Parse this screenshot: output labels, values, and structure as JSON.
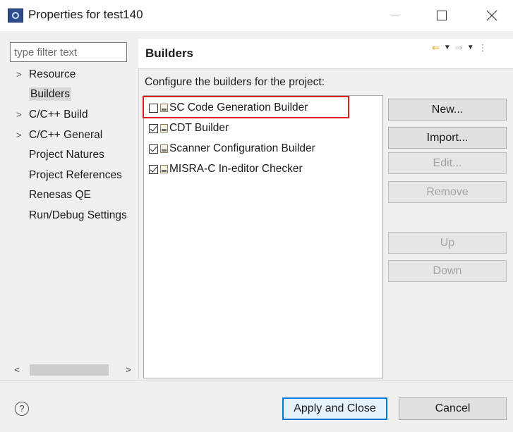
{
  "window": {
    "title": "Properties for test140",
    "icon": "eclipse-app-icon",
    "controls": [
      "minimize",
      "maximize",
      "close"
    ]
  },
  "filter": {
    "placeholder": "type filter text",
    "value": ""
  },
  "tree": {
    "items": [
      {
        "label": "Resource",
        "expandable": true,
        "selected": false
      },
      {
        "label": "Builders",
        "expandable": false,
        "selected": true
      },
      {
        "label": "C/C++ Build",
        "expandable": true,
        "selected": false
      },
      {
        "label": "C/C++ General",
        "expandable": true,
        "selected": false
      },
      {
        "label": "Project Natures",
        "expandable": false,
        "selected": false
      },
      {
        "label": "Project References",
        "expandable": false,
        "selected": false
      },
      {
        "label": "Renesas QE",
        "expandable": false,
        "selected": false
      },
      {
        "label": "Run/Debug Settings",
        "expandable": false,
        "selected": false
      }
    ],
    "chevron_glyph": ">",
    "scroll_left_glyph": "<",
    "scroll_right_glyph": ">"
  },
  "page": {
    "title": "Builders",
    "description": "Configure the builders for the project:"
  },
  "builders": [
    {
      "label": "SC Code Generation Builder",
      "checked": false
    },
    {
      "label": "CDT Builder",
      "checked": true
    },
    {
      "label": "Scanner Configuration Builder",
      "checked": true
    },
    {
      "label": "MISRA-C In-editor Checker",
      "checked": true
    }
  ],
  "buttons": {
    "new": {
      "label": "New...",
      "enabled": true
    },
    "import": {
      "label": "Import...",
      "enabled": true
    },
    "edit": {
      "label": "Edit...",
      "enabled": false
    },
    "remove": {
      "label": "Remove",
      "enabled": false
    },
    "up": {
      "label": "Up",
      "enabled": false
    },
    "down": {
      "label": "Down",
      "enabled": false
    }
  },
  "footer": {
    "help_glyph": "?",
    "apply_close": "Apply and Close",
    "cancel": "Cancel"
  },
  "colors": {
    "highlight": "#e0201c",
    "default_button_border": "#0078d7"
  }
}
